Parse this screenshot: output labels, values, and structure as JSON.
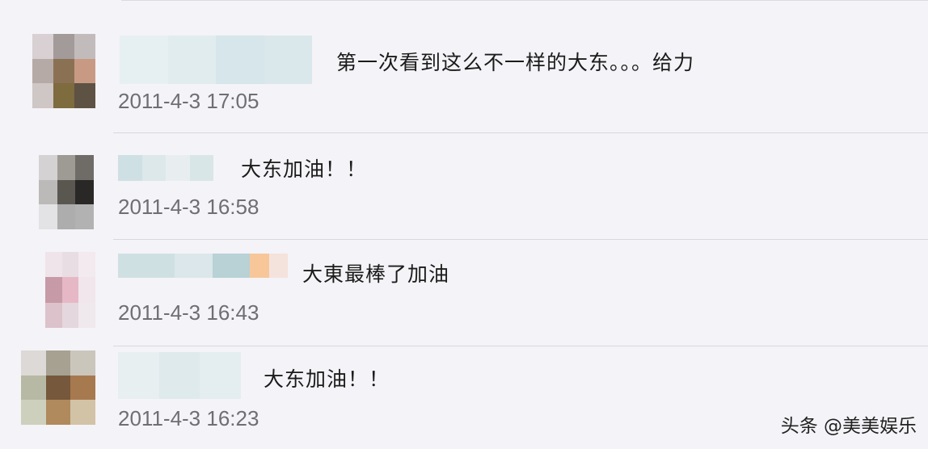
{
  "comments": [
    {
      "text": "第一次看到这么不一样的大东。。。给力",
      "time": "2011-4-3 17:05"
    },
    {
      "text": "大东加油！！",
      "time": "2011-4-3 16:58"
    },
    {
      "text": "大東最棒了加油",
      "time": "2011-4-3 16:43"
    },
    {
      "text": "大东加油！！",
      "time": "2011-4-3 16:23"
    }
  ],
  "watermark": "头条 @美美娱乐"
}
